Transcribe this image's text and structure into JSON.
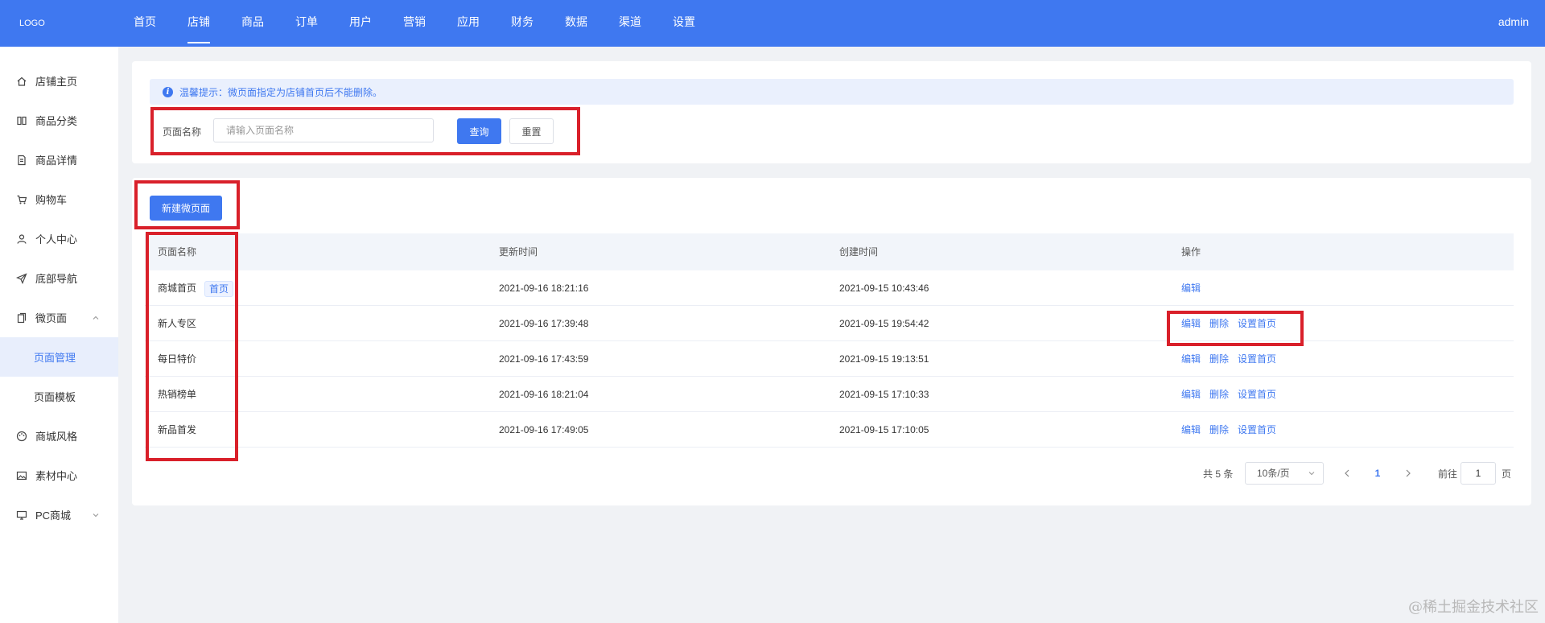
{
  "header": {
    "logo": "LOGO",
    "nav": [
      "首页",
      "店铺",
      "商品",
      "订单",
      "用户",
      "营销",
      "应用",
      "财务",
      "数据",
      "渠道",
      "设置"
    ],
    "active_index": 1,
    "user": "admin",
    "brand_color": "#3f78f0"
  },
  "sidebar": {
    "items": [
      {
        "label": "店铺主页",
        "icon": "home-icon"
      },
      {
        "label": "商品分类",
        "icon": "columns-icon"
      },
      {
        "label": "商品详情",
        "icon": "document-icon"
      },
      {
        "label": "购物车",
        "icon": "cart-icon"
      },
      {
        "label": "个人中心",
        "icon": "user-icon"
      },
      {
        "label": "底部导航",
        "icon": "send-icon"
      },
      {
        "label": "微页面",
        "icon": "pages-icon"
      },
      {
        "label": "页面管理",
        "icon": ""
      },
      {
        "label": "页面模板",
        "icon": ""
      },
      {
        "label": "商城风格",
        "icon": "palette-icon"
      },
      {
        "label": "素材中心",
        "icon": "image-icon"
      },
      {
        "label": "PC商城",
        "icon": "monitor-icon"
      }
    ],
    "active_index": 7
  },
  "tip": {
    "text": "温馨提示：微页面指定为店铺首页后不能删除。"
  },
  "search": {
    "label": "页面名称",
    "placeholder": "请输入页面名称",
    "query_button": "查询",
    "reset_button": "重置"
  },
  "create_button": "新建微页面",
  "table": {
    "columns": [
      "页面名称",
      "更新时间",
      "创建时间",
      "操作"
    ],
    "home_tag": "首页",
    "rows": [
      {
        "name": "商城首页",
        "is_home": true,
        "updated": "2021-09-16 18:21:16",
        "created": "2021-09-15 10:43:46",
        "ops": [
          "编辑"
        ]
      },
      {
        "name": "新人专区",
        "is_home": false,
        "updated": "2021-09-16 17:39:48",
        "created": "2021-09-15 19:54:42",
        "ops": [
          "编辑",
          "删除",
          "设置首页"
        ]
      },
      {
        "name": "每日特价",
        "is_home": false,
        "updated": "2021-09-16 17:43:59",
        "created": "2021-09-15 19:13:51",
        "ops": [
          "编辑",
          "删除",
          "设置首页"
        ]
      },
      {
        "name": "热销榜单",
        "is_home": false,
        "updated": "2021-09-16 18:21:04",
        "created": "2021-09-15 17:10:33",
        "ops": [
          "编辑",
          "删除",
          "设置首页"
        ]
      },
      {
        "name": "新品首发",
        "is_home": false,
        "updated": "2021-09-16 17:49:05",
        "created": "2021-09-15 17:10:05",
        "ops": [
          "编辑",
          "删除",
          "设置首页"
        ]
      }
    ]
  },
  "pagination": {
    "total": "共 5 条",
    "page_size": "10条/页",
    "current_page": "1",
    "goto_label": "前往",
    "goto_value": "1",
    "page_unit": "页"
  },
  "watermark": "@稀土掘金技术社区"
}
